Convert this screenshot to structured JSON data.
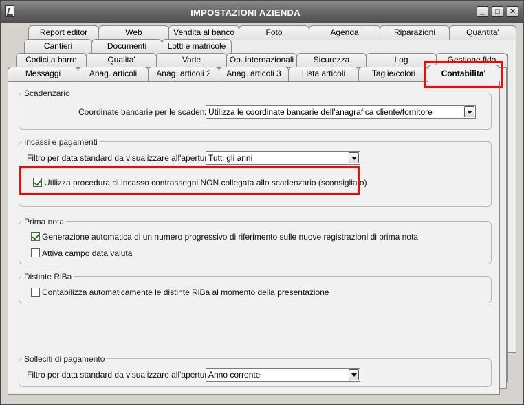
{
  "window": {
    "title": "IMPOSTAZIONI AZIENDA",
    "minimize": "_",
    "maximize": "□",
    "close": "✕"
  },
  "tabs": {
    "row1": [
      "Report editor",
      "Web",
      "Vendita al banco",
      "Foto",
      "Agenda",
      "Riparazioni",
      "Quantita'"
    ],
    "row2": [
      "Cantieri",
      "Documenti",
      "Lotti e matricole"
    ],
    "row3": [
      "Codici a barre",
      "Qualita'",
      "Varie",
      "Op. internazionali",
      "Sicurezza",
      "Log",
      "Gestione fido"
    ],
    "row4": [
      "Messaggi",
      "Anag. articoli",
      "Anag. articoli 2",
      "Anag. articoli 3",
      "Lista articoli",
      "Taglie/colori",
      "Contabilita'"
    ]
  },
  "scadenzario": {
    "title": "Scadenzario",
    "coord_label": "Coordinate bancarie per le scadenze :",
    "coord_value": "Utilizza le coordinate bancarie dell'anagrafica cliente/fornitore"
  },
  "incassi": {
    "title": "Incassi e pagamenti",
    "filtro_label": "Filtro per data standard da visualizzare all'apertura :",
    "filtro_value": "Tutti gli anni",
    "contrassegni_label": "Utilizza procedura di incasso contrassegni NON collegata allo scadenzario (sconsigliato)",
    "contrassegni_checked": true
  },
  "prima_nota": {
    "title": "Prima nota",
    "generazione_label": "Generazione automatica di un numero progressivo di riferimento sulle nuove registrazioni di prima nota",
    "generazione_checked": true,
    "data_valuta_label": "Attiva campo data valuta",
    "data_valuta_checked": false
  },
  "riba": {
    "title": "Distinte RiBa",
    "contabilizza_label": "Contabilizza automaticamente le distinte RiBa al momento della presentazione",
    "contabilizza_checked": false
  },
  "solleciti": {
    "title": "Solleciti di pagamento",
    "filtro_label": "Filtro per data standard da visualizzare all'apertura :",
    "filtro_value": "Anno corrente"
  },
  "colors": {
    "highlight": "#e01010",
    "check": "#2a7a12"
  }
}
